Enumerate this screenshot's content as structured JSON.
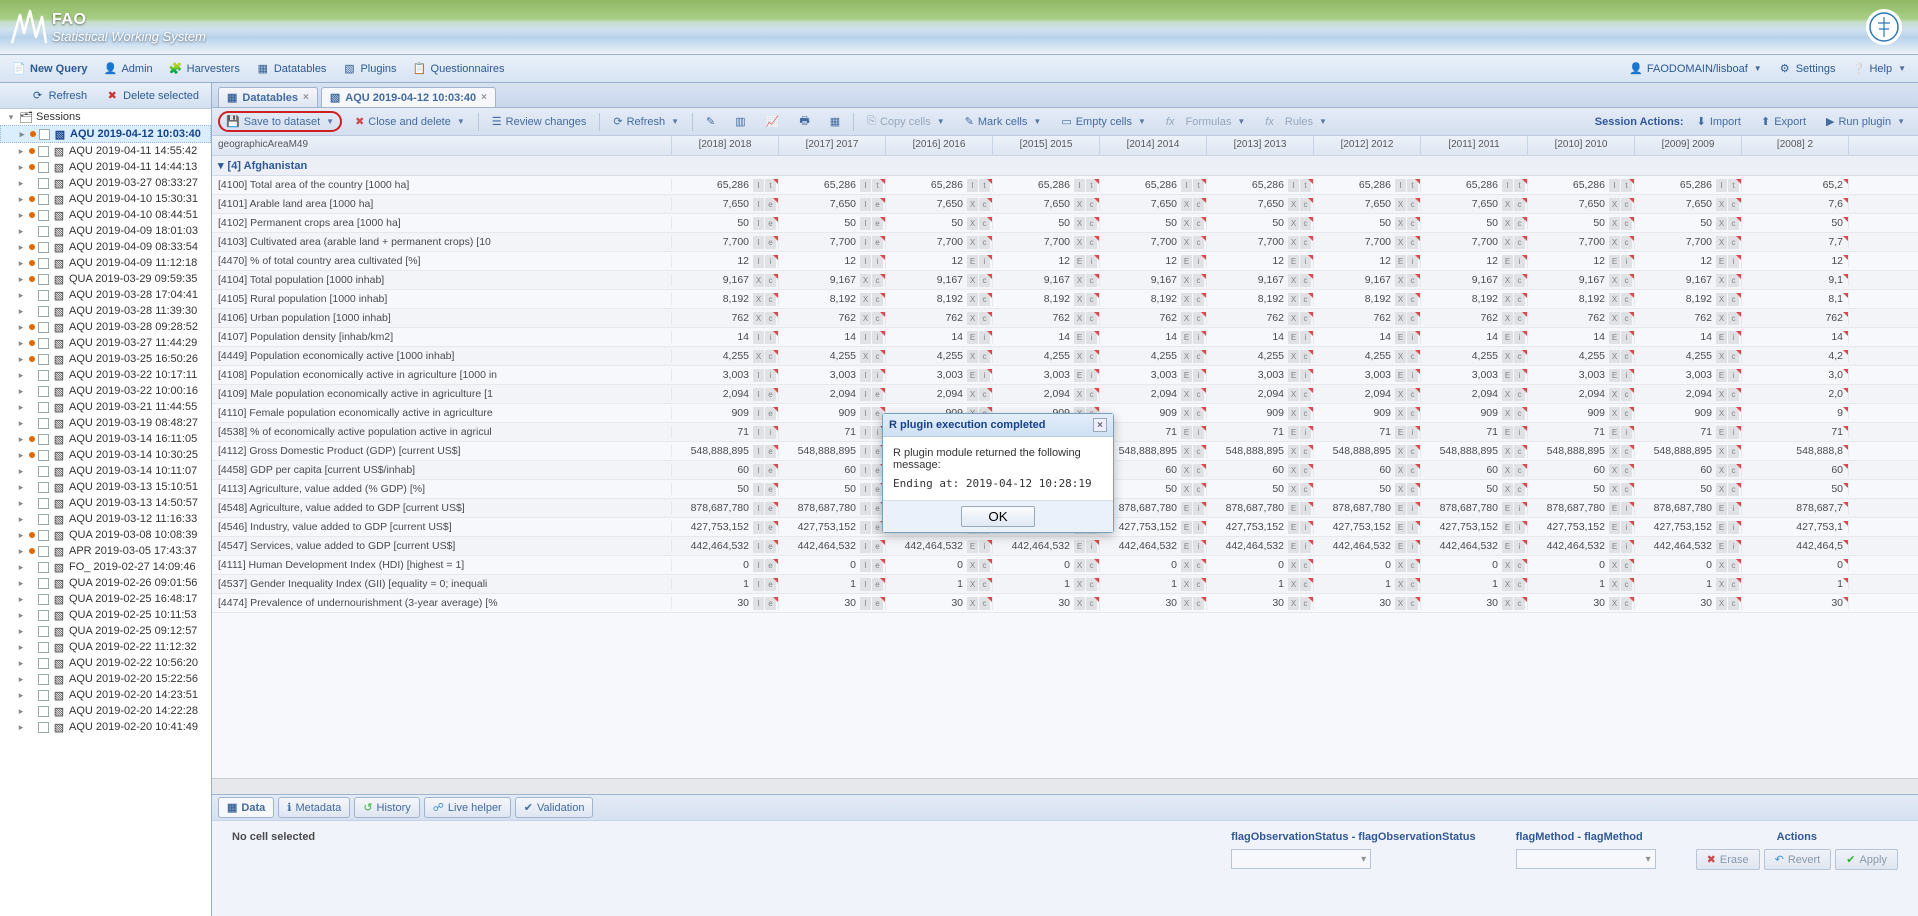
{
  "banner": {
    "line1": "FAO",
    "line2": "Statistical Working System",
    "logo_alt": "FAO"
  },
  "topbar": {
    "new_query": "New Query",
    "admin": "Admin",
    "harvesters": "Harvesters",
    "datatables": "Datatables",
    "plugins": "Plugins",
    "questionnaires": "Questionnaires",
    "user": "FAODOMAIN/lisboaf",
    "settings": "Settings",
    "help": "Help"
  },
  "left": {
    "refresh": "Refresh",
    "delete_selected": "Delete selected",
    "root": "Sessions",
    "items": [
      {
        "label": "AQU 2019-04-12 10:03:40",
        "dot": "#e06a00",
        "selected": true
      },
      {
        "label": "AQU 2019-04-11 14:55:42",
        "dot": "#e06a00"
      },
      {
        "label": "AQU 2019-04-11 14:44:13",
        "dot": "#e06a00"
      },
      {
        "label": "AQU 2019-03-27 08:33:27",
        "dot": ""
      },
      {
        "label": "AQU 2019-04-10 15:30:31",
        "dot": "#e06a00"
      },
      {
        "label": "AQU 2019-04-10 08:44:51",
        "dot": "#e06a00"
      },
      {
        "label": "AQU 2019-04-09 18:01:03",
        "dot": ""
      },
      {
        "label": "AQU 2019-04-09 08:33:54",
        "dot": "#e06a00"
      },
      {
        "label": "AQU 2019-04-09 11:12:18",
        "dot": "#e06a00"
      },
      {
        "label": "QUA 2019-03-29 09:59:35",
        "dot": "#e06a00"
      },
      {
        "label": "AQU 2019-03-28 17:04:41",
        "dot": ""
      },
      {
        "label": "AQU 2019-03-28 11:39:30",
        "dot": ""
      },
      {
        "label": "AQU 2019-03-28 09:28:52",
        "dot": "#e06a00"
      },
      {
        "label": "AQU 2019-03-27 11:44:29",
        "dot": "#e06a00"
      },
      {
        "label": "AQU 2019-03-25 16:50:26",
        "dot": "#e06a00"
      },
      {
        "label": "AQU 2019-03-22 10:17:11",
        "dot": ""
      },
      {
        "label": "AQU 2019-03-22 10:00:16",
        "dot": ""
      },
      {
        "label": "AQU 2019-03-21 11:44:55",
        "dot": ""
      },
      {
        "label": "AQU 2019-03-19 08:48:27",
        "dot": ""
      },
      {
        "label": "AQU 2019-03-14 16:11:05",
        "dot": "#e06a00"
      },
      {
        "label": "AQU 2019-03-14 10:30:25",
        "dot": "#e06a00"
      },
      {
        "label": "AQU 2019-03-14 10:11:07",
        "dot": ""
      },
      {
        "label": "AQU 2019-03-13 15:10:51",
        "dot": ""
      },
      {
        "label": "AQU 2019-03-13 14:50:57",
        "dot": ""
      },
      {
        "label": "AQU 2019-03-12 11:16:33",
        "dot": ""
      },
      {
        "label": "QUA 2019-03-08 10:08:39",
        "dot": "#e06a00"
      },
      {
        "label": "APR 2019-03-05 17:43:37",
        "dot": "#e06a00"
      },
      {
        "label": "FO_ 2019-02-27 14:09:46",
        "dot": ""
      },
      {
        "label": "QUA 2019-02-26 09:01:56",
        "dot": ""
      },
      {
        "label": "QUA 2019-02-25 16:48:17",
        "dot": ""
      },
      {
        "label": "QUA 2019-02-25 10:11:53",
        "dot": ""
      },
      {
        "label": "QUA 2019-02-25 09:12:57",
        "dot": ""
      },
      {
        "label": "QUA 2019-02-22 11:12:32",
        "dot": ""
      },
      {
        "label": "AQU 2019-02-22 10:56:20",
        "dot": ""
      },
      {
        "label": "AQU 2019-02-20 15:22:56",
        "dot": ""
      },
      {
        "label": "AQU 2019-02-20 14:23:51",
        "dot": ""
      },
      {
        "label": "AQU 2019-02-20 14:22:28",
        "dot": ""
      },
      {
        "label": "AQU 2019-02-20 10:41:49",
        "dot": ""
      }
    ]
  },
  "tabs": {
    "t1": "Datatables",
    "t2": "AQU 2019-04-12 10:03:40"
  },
  "dtoolbar": {
    "save": "Save to dataset",
    "close": "Close and delete",
    "review": "Review changes",
    "refresh": "Refresh",
    "copy": "Copy cells",
    "mark": "Mark cells",
    "empty": "Empty cells",
    "formulas": "Formulas",
    "rules": "Rules",
    "session_actions": "Session Actions:",
    "import": "Import",
    "export": "Export",
    "run_plugin": "Run plugin"
  },
  "colheader": {
    "rowhead": "geographicAreaM49",
    "years": [
      "[2018] 2018",
      "[2017] 2017",
      "[2016] 2016",
      "[2015] 2015",
      "[2014] 2014",
      "[2013] 2013",
      "[2012] 2012",
      "[2011] 2011",
      "[2010] 2010",
      "[2009] 2009",
      "[2008] 2"
    ]
  },
  "grouprow": "[4] Afghanistan",
  "rows": [
    {
      "label": "[4100] Total area of the country [1000 ha]",
      "v": "65,286",
      "f1": "I",
      "f2": "t",
      "last": "65,2"
    },
    {
      "label": "[4101] Arable land area [1000 ha]",
      "v": "7,650",
      "f1": "I",
      "f2": "e",
      "alt": {
        "f1": "X",
        "f2": "c"
      },
      "last": "7,6"
    },
    {
      "label": "[4102] Permanent crops area [1000 ha]",
      "v": "50",
      "f1": "I",
      "f2": "e",
      "alt": {
        "f1": "X",
        "f2": "c"
      }
    },
    {
      "label": "[4103] Cultivated area (arable land + permanent crops) [10",
      "v": "7,700",
      "f1": "I",
      "f2": "e",
      "alt": {
        "f1": "X",
        "f2": "c"
      },
      "last": "7,7"
    },
    {
      "label": "[4470] % of total country area cultivated [%]",
      "v": "12",
      "f1": "I",
      "f2": "i",
      "alt": {
        "f1": "E",
        "f2": "i"
      }
    },
    {
      "label": "[4104] Total population [1000 inhab]",
      "v": "9,167",
      "f1": "X",
      "f2": "c",
      "last": "9,1"
    },
    {
      "label": "[4105] Rural population [1000 inhab]",
      "v": "8,192",
      "f1": "X",
      "f2": "c",
      "last": "8,1"
    },
    {
      "label": "[4106] Urban population [1000 inhab]",
      "v": "762",
      "f1": "X",
      "f2": "c",
      "last": "762"
    },
    {
      "label": "[4107] Population density [inhab/km2]",
      "v": "14",
      "f1": "I",
      "f2": "i",
      "alt": {
        "f1": "E",
        "f2": "i"
      }
    },
    {
      "label": "[4449] Population economically active [1000 inhab]",
      "v": "4,255",
      "f1": "X",
      "f2": "c",
      "last": "4,2"
    },
    {
      "label": "[4108] Population economically active in agriculture [1000 in",
      "v": "3,003",
      "f1": "I",
      "f2": "i",
      "alt": {
        "f1": "E",
        "f2": "i"
      },
      "last": "3,0"
    },
    {
      "label": "[4109] Male population economically active in agriculture [1",
      "v": "2,094",
      "f1": "I",
      "f2": "e",
      "alt": {
        "f1": "X",
        "f2": "c"
      },
      "last": "2,0"
    },
    {
      "label": "[4110] Female population economically active in agriculture",
      "v": "909",
      "f1": "I",
      "f2": "e",
      "alt": {
        "f1": "X",
        "f2": "c"
      },
      "last": "9"
    },
    {
      "label": "[4538] % of economically active population active in agricul",
      "v": "71",
      "f1": "I",
      "f2": "i",
      "alt": {
        "f1": "E",
        "f2": "i"
      }
    },
    {
      "label": "[4112] Gross Domestic Product (GDP) [current US$]",
      "v": "548,888,895",
      "f1": "I",
      "f2": "e",
      "alt": {
        "f1": "X",
        "f2": "c"
      },
      "last": "548,888,8"
    },
    {
      "label": "[4458] GDP per capita [current US$/inhab]",
      "v": "60",
      "f1": "I",
      "f2": "e",
      "alt": {
        "f1": "X",
        "f2": "c"
      }
    },
    {
      "label": "[4113] Agriculture, value added (% GDP) [%]",
      "v": "50",
      "f1": "I",
      "f2": "e",
      "alt": {
        "f1": "X",
        "f2": "c"
      }
    },
    {
      "label": "[4548] Agriculture, value added to GDP [current US$]",
      "v": "878,687,780",
      "f1": "I",
      "f2": "e",
      "alt": {
        "f1": "E",
        "f2": "i"
      },
      "last": "878,687,7"
    },
    {
      "label": "[4546] Industry, value added to GDP [current US$]",
      "v": "427,753,152",
      "f1": "I",
      "f2": "e",
      "alt": {
        "f1": "E",
        "f2": "i"
      },
      "last": "427,753,1"
    },
    {
      "label": "[4547] Services, value added to GDP [current US$]",
      "v": "442,464,532",
      "f1": "I",
      "f2": "e",
      "alt": {
        "f1": "E",
        "f2": "i"
      },
      "last": "442,464,5"
    },
    {
      "label": "[4111] Human Development Index (HDI) [highest = 1]",
      "v": "0",
      "f1": "I",
      "f2": "e",
      "alt": {
        "f1": "X",
        "f2": "c"
      }
    },
    {
      "label": "[4537] Gender Inequality Index (GII) [equality = 0; inequali",
      "v": "1",
      "f1": "I",
      "f2": "e",
      "alt": {
        "f1": "X",
        "f2": "c"
      }
    },
    {
      "label": "[4474] Prevalence of undernourishment (3-year average) [%",
      "v": "30",
      "f1": "I",
      "f2": "e",
      "alt": {
        "f1": "X",
        "f2": "c"
      }
    }
  ],
  "bottomtabs": {
    "data": "Data",
    "metadata": "Metadata",
    "history": "History",
    "live": "Live helper",
    "validation": "Validation"
  },
  "footer": {
    "nocell": "No cell selected",
    "flag1_hdr": "flagObservationStatus - flagObservationStatus",
    "flag2_hdr": "flagMethod - flagMethod",
    "actions_hdr": "Actions",
    "erase": "Erase",
    "revert": "Revert",
    "apply": "Apply"
  },
  "modal": {
    "title": "R plugin execution completed",
    "line1": "R plugin module returned the following message:",
    "line2": "Ending at: 2019-04-12 10:28:19",
    "ok": "OK"
  }
}
